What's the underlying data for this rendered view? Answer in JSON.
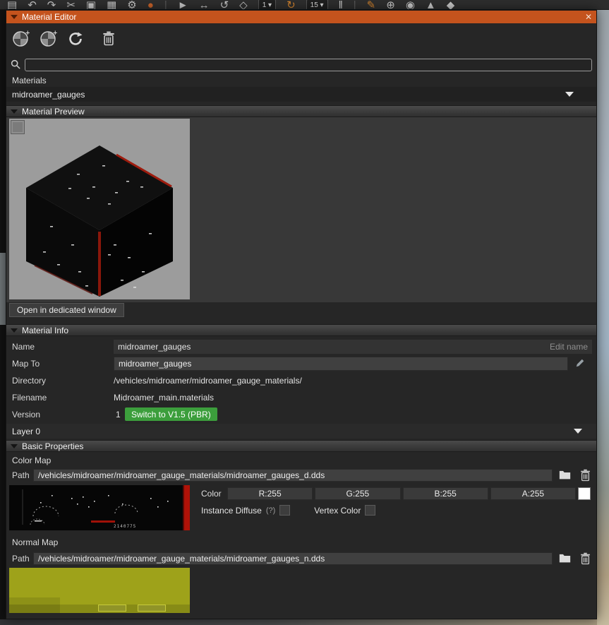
{
  "window": {
    "title": "Material Editor",
    "close_glyph": "✕"
  },
  "top_toolbar": {
    "items": [
      {
        "name": "save-icon",
        "glyph": "▤"
      },
      {
        "name": "undo-icon",
        "glyph": "↶"
      },
      {
        "name": "redo-icon",
        "glyph": "↷"
      },
      {
        "name": "cut-icon",
        "glyph": "✂"
      },
      {
        "name": "copy-icon",
        "glyph": "▣"
      },
      {
        "name": "paste-icon",
        "glyph": "▦"
      },
      {
        "name": "settings-gear-icon",
        "glyph": "⚙"
      },
      {
        "name": "vehicle-icon",
        "glyph": "●",
        "color": "#c9632a"
      },
      {
        "name": "separator",
        "glyph": "|",
        "sep": true
      },
      {
        "name": "select-icon",
        "glyph": "►"
      },
      {
        "name": "translate-icon",
        "glyph": "↔"
      },
      {
        "name": "rotate-icon",
        "glyph": "↺"
      },
      {
        "name": "scale-icon",
        "glyph": "◇"
      },
      {
        "name": "snap-size-dropdown",
        "text": "1"
      },
      {
        "name": "reload-icon",
        "glyph": "↻",
        "color": "#d2832e"
      },
      {
        "name": "angle-snap-dropdown",
        "text": "15"
      },
      {
        "name": "pause-icon",
        "glyph": "‖"
      },
      {
        "name": "separator",
        "glyph": "|",
        "sep": true
      },
      {
        "name": "draw-pencil-icon",
        "glyph": "✎",
        "color": "#d2832e"
      },
      {
        "name": "add-icon",
        "glyph": "⊕"
      },
      {
        "name": "forest-icon",
        "glyph": "◉"
      },
      {
        "name": "terrain-icon",
        "glyph": "▲"
      },
      {
        "name": "decal-icon",
        "glyph": "◆"
      }
    ]
  },
  "search": {
    "placeholder": "",
    "value": ""
  },
  "materials": {
    "label": "Materials",
    "selected": "midroamer_gauges"
  },
  "sections": {
    "preview": "Material Preview",
    "info": "Material Info",
    "basic": "Basic Properties"
  },
  "preview": {
    "open_button": "Open in dedicated window"
  },
  "info": {
    "rows": [
      {
        "label": "Name",
        "value": "midroamer_gauges",
        "action": "Edit name"
      },
      {
        "label": "Map To",
        "value": "midroamer_gauges"
      },
      {
        "label": "Directory",
        "value": "/vehicles/midroamer/midroamer_gauge_materials/"
      },
      {
        "label": "Filename",
        "value": "Midroamer_main.materials"
      },
      {
        "label": "Version",
        "value": "1",
        "action": "Switch to V1.5 (PBR)"
      }
    ]
  },
  "layer": {
    "selected": "Layer 0"
  },
  "color_map": {
    "label": "Color Map",
    "path_label": "Path",
    "path": "/vehicles/midroamer/midroamer_gauge_materials/midroamer_gauges_d.dds",
    "color_label": "Color",
    "channels": [
      "R:255",
      "G:255",
      "B:255",
      "A:255"
    ],
    "instance_diffuse_label": "Instance Diffuse",
    "instance_diffuse_hint": "(?)",
    "vertex_color_label": "Vertex Color",
    "texture_odometer": "2140775"
  },
  "normal_map": {
    "label": "Normal Map",
    "path_label": "Path",
    "path": "/vehicles/midroamer/midroamer_gauge_materials/midroamer_gauges_n.dds"
  },
  "colors": {
    "titlebar": "#c4531d",
    "green_button": "#3c9e3c",
    "normal_texture": "#9ea21a",
    "color_swatch": "#ffffff"
  }
}
